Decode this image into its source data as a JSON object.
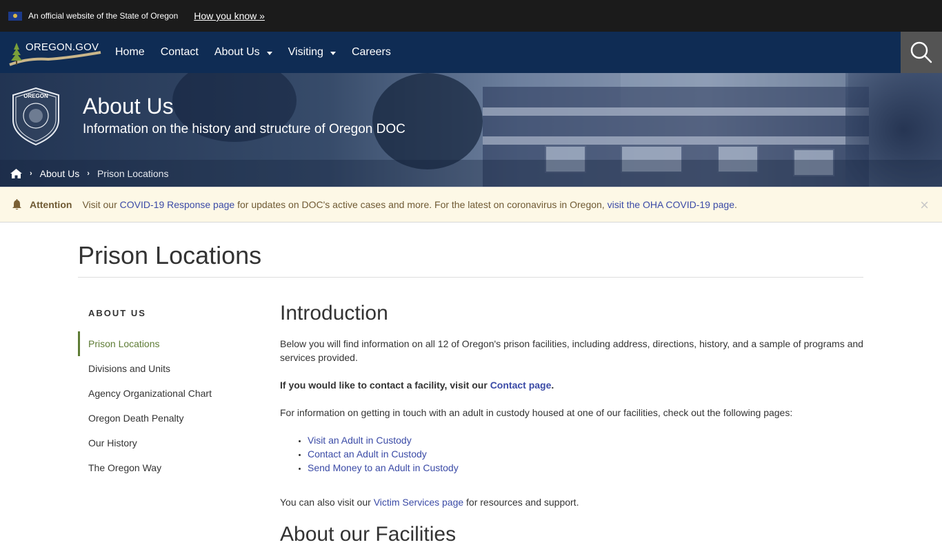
{
  "gov_banner": {
    "official_text": "An official website of the State of Oregon",
    "how_you_know": "How you know »"
  },
  "nav": {
    "logo_text": "OREGON.GOV",
    "items": [
      {
        "label": "Home",
        "has_dropdown": false
      },
      {
        "label": "Contact",
        "has_dropdown": false
      },
      {
        "label": "About Us",
        "has_dropdown": true
      },
      {
        "label": "Visiting",
        "has_dropdown": true
      },
      {
        "label": "Careers",
        "has_dropdown": false
      }
    ],
    "search_icon": "search-icon"
  },
  "hero": {
    "title": "About Us",
    "subtitle": "Information on the history and structure of Oregon DOC",
    "seal_text": "OREGON",
    "breadcrumb": [
      {
        "label": "About Us"
      },
      {
        "label": "Prison Locations"
      }
    ]
  },
  "alert": {
    "label": "Attention",
    "text_1": "Visit our ",
    "link_1": "COVID-19 Response page",
    "text_2": " for updates on DOC's active cases and more. For the latest on coronavirus in Oregon, ",
    "link_2": "visit the OHA COVID-19 page",
    "text_3": ".",
    "close": "×"
  },
  "page": {
    "title": "Prison Locations"
  },
  "sidenav": {
    "heading": "ABOUT US",
    "items": [
      {
        "label": "Prison Locations",
        "active": true
      },
      {
        "label": "Divisions and Units",
        "active": false
      },
      {
        "label": "Agency Organizational Chart",
        "active": false
      },
      {
        "label": "Oregon Death Penalty",
        "active": false
      },
      {
        "label": "Our History",
        "active": false
      },
      {
        "label": "The Oregon Way",
        "active": false
      }
    ]
  },
  "main": {
    "intro_heading": "Introduction",
    "intro_paragraph": "Below you will find information on all 12 of Oregon's prison facilities, including address, directions, history, and a sample of programs and services provided.",
    "contact_text": "If you would like to contact a facility, visit our ",
    "contact_link": "Contact page",
    "contact_end": ".",
    "touch_paragraph": "For information on getting in touch with an adult in custody housed at one of our facilities, check out the following pages:",
    "links": [
      "Visit an Adult in Custody",
      "Contact an Adult in Custody",
      "Send Money to an Adult in Custody"
    ],
    "victim_text_1": "You can also visit our ",
    "victim_link": "Victim Services page",
    "victim_text_2": " for resources and support.",
    "facilities_heading": "About our Facilities"
  },
  "colors": {
    "banner_bg": "#1b1b1b",
    "nav_bg": "#0f2c54",
    "search_bg": "#545454",
    "alert_bg": "#fdf8e6",
    "link": "#3a4aa6",
    "sidenav_active": "#5e7c35"
  }
}
